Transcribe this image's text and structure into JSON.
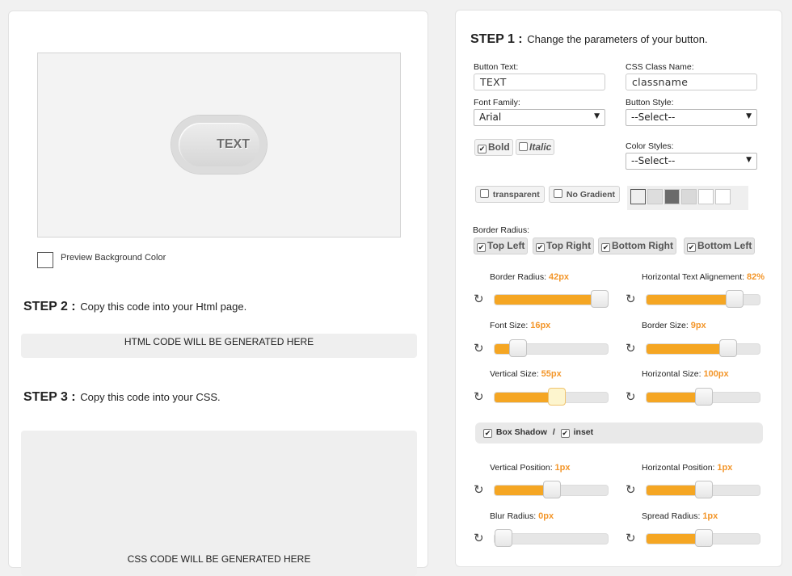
{
  "preview": {
    "button_text": "TEXT",
    "bg_color_label": "Preview Background Color"
  },
  "step1": {
    "title": "STEP 1 :",
    "desc": "Change the parameters of your button."
  },
  "step2": {
    "title": "STEP 2 :",
    "desc": "Copy this code into your Html page.",
    "placeholder": "HTML CODE WILL BE GENERATED HERE"
  },
  "step3": {
    "title": "STEP 3 :",
    "desc": "Copy this code into your CSS.",
    "placeholder": "CSS CODE WILL BE GENERATED HERE"
  },
  "form": {
    "button_text_label": "Button Text:",
    "button_text_value": "TEXT",
    "css_class_label": "CSS Class Name:",
    "css_class_value": "classname",
    "font_family_label": "Font Family:",
    "font_family_value": "Arial",
    "button_style_label": "Button Style:",
    "button_style_value": "--Select--",
    "bold_label": "Bold",
    "bold_checked": true,
    "italic_label": "Italic",
    "italic_checked": false,
    "color_styles_label": "Color Styles:",
    "color_styles_value": "--Select--",
    "transparent_label": "transparent",
    "no_gradient_label": "No Gradient",
    "swatches": [
      "#efefef",
      "#dddddd",
      "#6b6b6b",
      "#d9d9d9",
      "#ffffff",
      "#ffffff"
    ],
    "border_radius_label": "Border Radius:",
    "corners": [
      {
        "label": "Top Left",
        "checked": true
      },
      {
        "label": "Top Right",
        "checked": true
      },
      {
        "label": "Bottom Right",
        "checked": true
      },
      {
        "label": "Bottom Left",
        "checked": true
      }
    ]
  },
  "sliders": {
    "border_radius": {
      "label": "Border Radius:",
      "value": "42px",
      "fraction": 0.99
    },
    "h_text_align": {
      "label": "Horizontal Text Alignement:",
      "value": "82%",
      "fraction": 0.82
    },
    "font_size": {
      "label": "Font Size:",
      "value": "16px",
      "fraction": 0.15
    },
    "border_size": {
      "label": "Border Size:",
      "value": "9px",
      "fraction": 0.75
    },
    "vertical_size": {
      "label": "Vertical Size:",
      "value": "55px",
      "fraction": 0.55
    },
    "horizontal_size": {
      "label": "Horizontal Size:",
      "value": "100px",
      "fraction": 0.5
    },
    "v_position": {
      "label": "Vertical Position:",
      "value": "1px",
      "fraction": 0.5
    },
    "h_position": {
      "label": "Horizontal Position:",
      "value": "1px",
      "fraction": 0.5
    },
    "blur_radius": {
      "label": "Blur Radius:",
      "value": "0px",
      "fraction": 0.0
    },
    "spread_radius": {
      "label": "Spread Radius:",
      "value": "1px",
      "fraction": 0.5
    }
  },
  "shadow": {
    "box_shadow_label": "Box Shadow",
    "separator": "/",
    "inset_label": "inset",
    "box_shadow_checked": true,
    "inset_checked": true
  },
  "colors": {
    "accent": "#f5a623",
    "value_text": "#f3962a"
  }
}
